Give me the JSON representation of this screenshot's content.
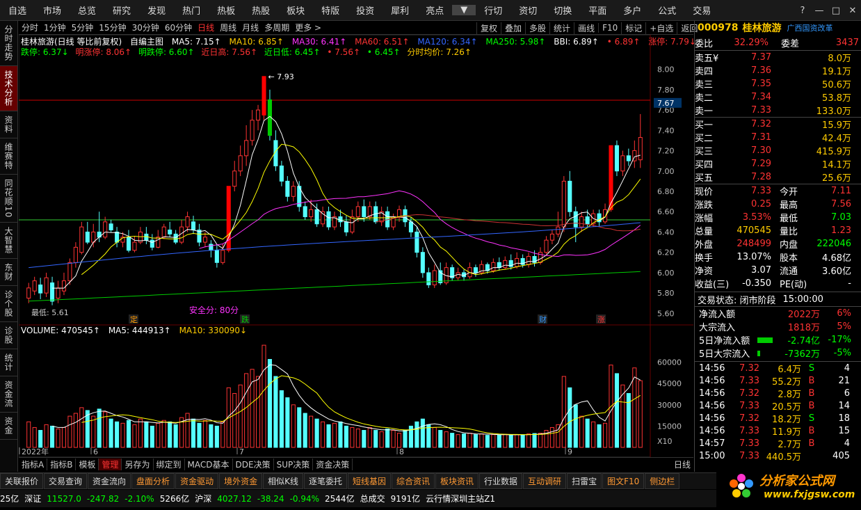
{
  "topmenu": [
    "自选",
    "市场",
    "总览",
    "研究",
    "发现",
    "热门",
    "热板",
    "热股",
    "板块",
    "特版",
    "投资",
    "犀利",
    "亮点",
    "▼",
    "行切",
    "资切",
    "切换",
    "平面",
    "多户",
    "公式",
    "交易"
  ],
  "window_ctrl": [
    "?",
    "—",
    "□",
    "✕"
  ],
  "left_tabs": [
    "分时走势",
    "技术分析",
    "资料",
    "维赛特",
    "同花顺10",
    "大智慧",
    "东财",
    "诊个股",
    "诊股",
    "统计",
    "资金流",
    "资金"
  ],
  "period_tools": [
    "分时",
    "1分钟",
    "5分钟",
    "15分钟",
    "30分钟",
    "60分钟",
    "日线",
    "周线",
    "月线",
    "多周期",
    "更多 >"
  ],
  "right_tools": [
    "复权",
    "叠加",
    "多股",
    "统计",
    "画线",
    "F10",
    "标记",
    "+自选",
    "返回"
  ],
  "ma_line": {
    "name": "桂林旅游(日线 等比前复权)",
    "main": "自编主图",
    "ma5": "MA5: 7.15↑",
    "ma10": "MA10: 6.85↑",
    "ma30": "MA30: 6.41↑",
    "ma60": "MA60: 6.51↑",
    "ma120": "MA120: 6.34↑",
    "ma250": "MA250: 5.98↑",
    "bbi": "BBI: 6.89↑",
    "ext": "• 6.89↑",
    "zt": "涨停: 7.79↓"
  },
  "ma_line2": {
    "dt": "跌停: 6.37↓",
    "mdt": "明涨停: 8.06↑",
    "mdt2": "明跌停: 6.60↑",
    "high": "近日高: 7.56↑",
    "low": "近日低: 6.45↑",
    "v1": "• 7.56↑",
    "v2": "• 6.45↑",
    "avg": "分时均价: 7.26↑"
  },
  "annot": {
    "peak": "← 7.93",
    "low": "最低: 5.61",
    "safe": "安全分: 80分",
    "cur_price": "7.67",
    "ex1": "定",
    "ex2": "跌",
    "ex3": "财",
    "ex4": "涨"
  },
  "vol_line": {
    "v": "VOLUME: 470545↑",
    "ma5": "MA5: 444913↑",
    "ma10": "MA10: 330090↓"
  },
  "price_axis": [
    "8.00",
    "7.80",
    "7.60",
    "7.40",
    "7.20",
    "7.00",
    "6.80",
    "6.60",
    "6.40",
    "6.20",
    "6.00",
    "5.80",
    "5.60"
  ],
  "vol_axis": [
    "60000",
    "45000",
    "30000",
    "15000"
  ],
  "vol_unit": "X10",
  "date_axis": [
    "2022年",
    "6",
    "7",
    "8",
    "9"
  ],
  "bottom_tabs": [
    "指标A",
    "指标B",
    "模板",
    "管理",
    "另存为",
    "绑定到",
    "MACD基本",
    "DDE决策",
    "SUP决策",
    "资金决策"
  ],
  "day_label": "日线",
  "funcbar": [
    "关联报价",
    "交易查询",
    "资金流向",
    "盘面分析",
    "资金驱动",
    "境外资金",
    "相似K线",
    "逐笔委托",
    "短线基因",
    "综合资讯",
    "板块资讯",
    "行业数据",
    "互动调研",
    "扫雷宝",
    "图文F10",
    "侧边栏"
  ],
  "status": {
    "s1": "25亿",
    "sz": "深证",
    "sz_v": "11527.0",
    "sz_c": "-247.82",
    "sz_p": "-2.10%",
    "sz_a": "5266亿",
    "sh": "沪深",
    "sh_v": "4027.12",
    "sh_c": "-38.24",
    "sh_p": "-0.94%",
    "sh_a": "2544亿",
    "tot": "总成交",
    "tot_v": "9191亿",
    "server": "云行情深圳主站Z1"
  },
  "stock": {
    "code": "000978",
    "name": "桂林旅游",
    "sector": "广西国资改革"
  },
  "quote": {
    "wb": "委比",
    "wb_v": "32.29%",
    "wc": "委差",
    "wc_v": "3437",
    "asks": [
      [
        "卖五¥",
        "7.37",
        "8.0万"
      ],
      [
        "卖四",
        "7.36",
        "19.1万"
      ],
      [
        "卖三",
        "7.35",
        "50.6万"
      ],
      [
        "卖二",
        "7.34",
        "53.8万"
      ],
      [
        "卖一",
        "7.33",
        "133.0万"
      ]
    ],
    "bids": [
      [
        "买一",
        "7.32",
        "15.9万"
      ],
      [
        "买二",
        "7.31",
        "42.4万"
      ],
      [
        "买三",
        "7.30",
        "415.9万"
      ],
      [
        "买四",
        "7.29",
        "14.1万"
      ],
      [
        "买五",
        "7.28",
        "25.6万"
      ]
    ],
    "stats": [
      [
        "现价",
        "7.33",
        "今开",
        "7.11"
      ],
      [
        "涨跌",
        "0.25",
        "最高",
        "7.56"
      ],
      [
        "涨幅",
        "3.53%",
        "最低",
        "7.03"
      ],
      [
        "总量",
        "470545",
        "量比",
        "1.23"
      ],
      [
        "外盘",
        "248499",
        "内盘",
        "222046"
      ],
      [
        "换手",
        "13.07%",
        "股本",
        "4.68亿"
      ],
      [
        "净资",
        "3.07",
        "流通",
        "3.60亿"
      ],
      [
        "收益(三)",
        "-0.350",
        "PE(动)",
        "-"
      ]
    ],
    "trade_state": "交易状态: 闭市阶段",
    "trade_time": "15:00:00",
    "flows": [
      [
        "净流入额",
        "2022万",
        "6%"
      ],
      [
        "大宗流入",
        "1818万",
        "5%"
      ],
      [
        "5日净流入额",
        "-2.74亿",
        "-17%"
      ],
      [
        "5日大宗流入",
        "-7362万",
        "-5%"
      ]
    ],
    "ticks": [
      [
        "14:56",
        "7.32",
        "6.4万",
        "S",
        "4"
      ],
      [
        "14:56",
        "7.33",
        "55.2万",
        "B",
        "21"
      ],
      [
        "14:56",
        "7.32",
        "2.8万",
        "B",
        "6"
      ],
      [
        "14:56",
        "7.33",
        "20.5万",
        "B",
        "14"
      ],
      [
        "14:56",
        "7.32",
        "18.2万",
        "S",
        "18"
      ],
      [
        "14:56",
        "7.33",
        "11.9万",
        "B",
        "15"
      ],
      [
        "14:57",
        "7.33",
        "2.7万",
        "B",
        "4"
      ],
      [
        "15:00",
        "7.33",
        "440.5万",
        "",
        "405"
      ]
    ]
  },
  "logo": {
    "text": "分析家公式网",
    "url": "www.fxjgsw.com"
  },
  "chart_data": {
    "type": "candlestick",
    "title": "桂林旅游(日线 等比前复权)",
    "ylim": [
      5.5,
      8.1
    ],
    "candles": [
      [
        5.75,
        5.85,
        5.7,
        5.9
      ],
      [
        5.82,
        5.92,
        5.78,
        5.96
      ],
      [
        5.88,
        5.8,
        5.74,
        5.95
      ],
      [
        5.8,
        5.95,
        5.76,
        6.0
      ],
      [
        5.9,
        5.72,
        5.68,
        5.96
      ],
      [
        5.75,
        5.85,
        5.7,
        5.92
      ],
      [
        5.82,
        5.92,
        5.78,
        6.0
      ],
      [
        5.92,
        6.1,
        5.88,
        6.14
      ],
      [
        6.1,
        6.25,
        6.05,
        6.3
      ],
      [
        6.2,
        6.45,
        6.18,
        6.5
      ],
      [
        6.4,
        6.3,
        6.28,
        6.5
      ],
      [
        6.3,
        6.4,
        6.25,
        6.48
      ],
      [
        6.4,
        6.35,
        6.3,
        6.6
      ],
      [
        6.35,
        6.5,
        6.33,
        6.55
      ],
      [
        6.48,
        6.42,
        6.4,
        6.52
      ],
      [
        6.4,
        6.3,
        6.25,
        6.45
      ],
      [
        6.3,
        6.35,
        6.25,
        6.4
      ],
      [
        6.35,
        6.22,
        6.2,
        6.42
      ],
      [
        6.22,
        6.3,
        6.2,
        6.36
      ],
      [
        6.3,
        6.4,
        6.28,
        6.45
      ],
      [
        6.38,
        6.32,
        6.28,
        6.45
      ],
      [
        6.32,
        6.25,
        6.22,
        6.38
      ],
      [
        6.25,
        6.35,
        6.24,
        6.42
      ],
      [
        6.35,
        6.45,
        6.33,
        6.48
      ],
      [
        6.42,
        6.38,
        6.35,
        6.5
      ],
      [
        6.38,
        6.3,
        6.28,
        6.42
      ],
      [
        6.3,
        6.45,
        6.28,
        6.52
      ],
      [
        6.45,
        6.55,
        6.4,
        6.6
      ],
      [
        6.5,
        6.42,
        6.38,
        6.56
      ],
      [
        6.42,
        6.3,
        6.26,
        6.48
      ],
      [
        6.3,
        6.35,
        6.25,
        6.4
      ],
      [
        6.28,
        6.22,
        6.15,
        6.32
      ],
      [
        6.22,
        6.1,
        6.05,
        6.28
      ],
      [
        6.1,
        6.22,
        6.08,
        6.28
      ],
      [
        6.22,
        6.85,
        6.2,
        6.85
      ],
      [
        6.85,
        7.0,
        6.8,
        7.1
      ],
      [
        7.0,
        7.15,
        6.95,
        7.25
      ],
      [
        7.15,
        7.3,
        7.05,
        7.45
      ],
      [
        7.3,
        7.5,
        7.25,
        7.6
      ],
      [
        7.5,
        7.6,
        7.4,
        7.65
      ],
      [
        7.55,
        7.93,
        7.5,
        7.93
      ],
      [
        7.7,
        7.35,
        7.3,
        7.8
      ],
      [
        7.3,
        7.05,
        7.0,
        7.4
      ],
      [
        7.05,
        6.9,
        6.85,
        7.1
      ],
      [
        6.9,
        6.75,
        6.7,
        6.95
      ],
      [
        6.75,
        6.85,
        6.7,
        6.9
      ],
      [
        6.85,
        6.65,
        6.6,
        6.9
      ],
      [
        6.65,
        6.55,
        6.52,
        6.7
      ],
      [
        6.55,
        6.62,
        6.5,
        6.72
      ],
      [
        6.62,
        6.48,
        6.45,
        6.68
      ],
      [
        6.48,
        6.6,
        6.45,
        6.65
      ],
      [
        6.6,
        6.45,
        6.42,
        6.65
      ],
      [
        6.45,
        6.55,
        6.42,
        6.6
      ],
      [
        6.55,
        6.5,
        6.45,
        6.62
      ],
      [
        6.5,
        6.4,
        6.36,
        6.56
      ],
      [
        6.4,
        6.55,
        6.38,
        6.62
      ],
      [
        6.55,
        6.65,
        6.5,
        6.7
      ],
      [
        6.65,
        6.55,
        6.5,
        6.72
      ],
      [
        6.55,
        6.65,
        6.52,
        6.7
      ],
      [
        6.65,
        6.5,
        6.48,
        6.7
      ],
      [
        6.5,
        6.6,
        6.46,
        6.65
      ],
      [
        6.6,
        6.45,
        6.42,
        6.65
      ],
      [
        6.45,
        6.55,
        6.42,
        6.58
      ],
      [
        6.55,
        6.62,
        6.5,
        6.66
      ],
      [
        6.62,
        6.5,
        6.45,
        6.66
      ],
      [
        6.5,
        6.4,
        6.35,
        6.55
      ],
      [
        6.4,
        6.2,
        6.15,
        6.45
      ],
      [
        6.2,
        6.0,
        5.95,
        6.25
      ],
      [
        6.0,
        5.88,
        5.85,
        6.05
      ],
      [
        5.88,
        6.02,
        5.85,
        6.08
      ],
      [
        6.02,
        5.9,
        5.88,
        6.1
      ],
      [
        5.9,
        6.05,
        5.88,
        6.1
      ],
      [
        6.05,
        5.95,
        5.92,
        6.08
      ],
      [
        5.95,
        6.0,
        5.92,
        6.05
      ],
      [
        6.0,
        5.96,
        5.92,
        6.03
      ],
      [
        5.96,
        6.05,
        5.94,
        6.1
      ],
      [
        6.05,
        6.0,
        5.96,
        6.08
      ],
      [
        6.0,
        6.08,
        5.98,
        6.12
      ],
      [
        6.08,
        6.02,
        5.99,
        6.1
      ],
      [
        6.02,
        6.1,
        6.0,
        6.14
      ],
      [
        6.1,
        6.05,
        6.02,
        6.15
      ],
      [
        6.05,
        6.12,
        6.03,
        6.16
      ],
      [
        6.12,
        6.06,
        6.03,
        6.18
      ],
      [
        6.06,
        6.14,
        6.04,
        6.2
      ],
      [
        6.14,
        6.08,
        6.05,
        6.18
      ],
      [
        6.08,
        6.16,
        6.05,
        6.2
      ],
      [
        6.16,
        6.1,
        6.06,
        6.22
      ],
      [
        6.1,
        6.2,
        6.08,
        6.25
      ],
      [
        6.2,
        6.32,
        6.18,
        6.36
      ],
      [
        6.32,
        6.38,
        6.28,
        6.42
      ],
      [
        6.38,
        6.45,
        6.35,
        6.6
      ],
      [
        6.45,
        6.9,
        6.4,
        6.95
      ],
      [
        6.9,
        6.6,
        6.55,
        7.0
      ],
      [
        6.6,
        6.45,
        6.3,
        6.65
      ],
      [
        6.45,
        6.55,
        6.4,
        6.6
      ],
      [
        6.55,
        6.48,
        6.45,
        6.62
      ],
      [
        6.48,
        6.58,
        6.45,
        6.62
      ],
      [
        6.58,
        6.5,
        6.46,
        6.62
      ],
      [
        6.5,
        6.62,
        6.48,
        6.68
      ],
      [
        6.62,
        7.25,
        6.6,
        7.25
      ],
      [
        7.25,
        7.0,
        6.95,
        7.3
      ],
      [
        7.0,
        7.15,
        6.95,
        7.2
      ],
      [
        7.15,
        7.1,
        7.05,
        7.22
      ],
      [
        7.1,
        7.2,
        7.03,
        7.3
      ],
      [
        7.11,
        7.33,
        7.03,
        7.56
      ]
    ],
    "volume": [
      18000,
      14000,
      12000,
      16000,
      15000,
      13000,
      14000,
      22000,
      24000,
      28000,
      26000,
      22000,
      27000,
      25000,
      20000,
      18000,
      17000,
      19000,
      16000,
      20000,
      18000,
      15000,
      17000,
      19000,
      18000,
      16000,
      21000,
      24000,
      20000,
      17000,
      19000,
      16000,
      15000,
      18000,
      42000,
      38000,
      44000,
      52000,
      55000,
      50000,
      72000,
      62000,
      50000,
      40000,
      35000,
      30000,
      28000,
      24000,
      22000,
      20000,
      18000,
      16000,
      17000,
      18000,
      15000,
      14000,
      13000,
      12000,
      14000,
      12000,
      11000,
      13000,
      12000,
      10000,
      12000,
      15000,
      18000,
      20000,
      16000,
      14000,
      12000,
      11000,
      10000,
      9000,
      9500,
      10000,
      9000,
      9500,
      8500,
      9000,
      8800,
      9200,
      8500,
      9000,
      8800,
      9500,
      9800,
      10000,
      12000,
      14000,
      16000,
      50000,
      42000,
      30000,
      22000,
      20000,
      18000,
      16000,
      17000,
      58000,
      52000,
      44000,
      38000,
      56000,
      47000
    ]
  }
}
